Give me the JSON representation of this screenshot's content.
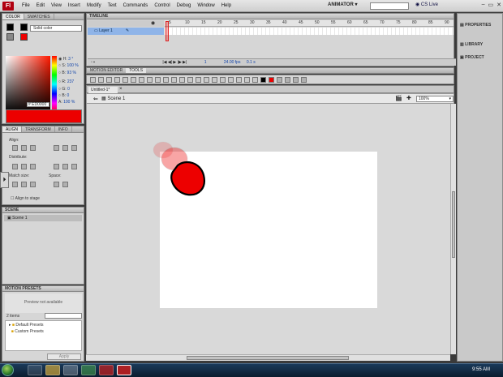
{
  "menu": {
    "items": [
      "File",
      "Edit",
      "View",
      "Insert",
      "Modify",
      "Text",
      "Commands",
      "Control",
      "Debug",
      "Window",
      "Help"
    ],
    "workspace": "ANIMATOR",
    "cslive": "CS Live"
  },
  "color_panel": {
    "tabs": [
      "COLOR",
      "SWATCHES"
    ],
    "fill_type": "Solid color",
    "h_label": "H:",
    "h_val": "3 °",
    "s_label": "S:",
    "s_val": "100 %",
    "b_label": "B:",
    "b_val": "93 %",
    "r_label": "R:",
    "r_val": "237",
    "g_label": "G:",
    "g_val": "0",
    "b2_label": "B:",
    "b2_val": "0",
    "hex": "ED0000",
    "a_label": "A:",
    "a_val": "100 %"
  },
  "align_panel": {
    "tabs": [
      "ALIGN",
      "TRANSFORM",
      "INFO"
    ],
    "align": "Align:",
    "distribute": "Distribute:",
    "match": "Match size:",
    "space": "Space:",
    "stage": "Align to stage"
  },
  "scene_panel": {
    "title": "SCENE",
    "item": "Scene 1"
  },
  "motion_presets": {
    "title": "MOTION PRESETS",
    "preview": "Preview not available",
    "count": "2 items",
    "folders": [
      "Default Presets",
      "Custom Presets"
    ],
    "apply": "Apply"
  },
  "timeline": {
    "title": "TIMELINE",
    "layer": "Layer 1",
    "frames": [
      "5",
      "10",
      "15",
      "20",
      "25",
      "30",
      "35",
      "40",
      "45",
      "50",
      "55",
      "60",
      "65",
      "70",
      "75",
      "80",
      "85",
      "90"
    ],
    "fps": "24.00 fps",
    "time": "0.1 s",
    "frame": "1"
  },
  "tabs": {
    "motion_editor": "MOTION EDITOR",
    "tools": "TOOLS"
  },
  "doc": {
    "tab": "Untitled-1*",
    "scene": "Scene 1",
    "zoom": "100%"
  },
  "right_panel": {
    "items": [
      "PROPERTIES",
      "LIBRARY",
      "PROJECT"
    ]
  },
  "taskbar": {
    "time": "9:55 AM"
  },
  "colors": {
    "fill": "#ED0000",
    "stroke": "#000000"
  }
}
